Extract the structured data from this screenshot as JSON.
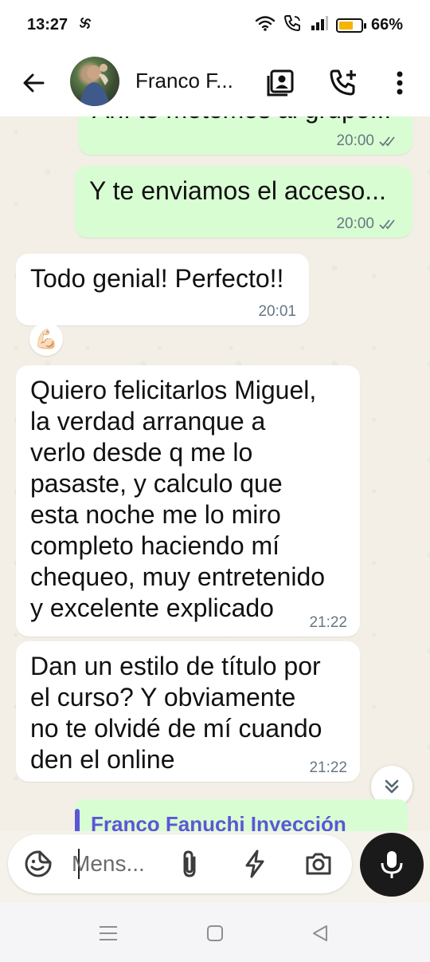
{
  "status_bar": {
    "time": "13:27",
    "extra_icon": "pinwheel-icon",
    "battery_percent": "66%",
    "battery_level": 0.66,
    "battery_color": "#f5b400"
  },
  "header": {
    "contact_name": "Franco F...",
    "back_icon": "arrow-left-icon",
    "icons": [
      "contact-card-icon",
      "add-call-icon",
      "more-vertical-icon"
    ]
  },
  "messages": [
    {
      "direction": "out",
      "text": "Ahí te metemos al grupo...",
      "time": "20:00",
      "status": "read"
    },
    {
      "direction": "out",
      "text": "Y te enviamos el acceso...",
      "time": "20:00",
      "status": "read"
    },
    {
      "direction": "in",
      "text": "Todo genial! Perfecto!!",
      "time": "20:01",
      "reaction": "💪🏻"
    },
    {
      "direction": "in",
      "text": "Quiero felicitarlos Miguel,\nla verdad arranque a\nverlo desde q me lo\npasaste, y calculo que\nesta noche me lo miro\ncompleto haciendo mí\nchequeo, muy entretenido\ny excelente explicado",
      "time": "21:22"
    },
    {
      "direction": "in",
      "text": "Dan un estilo de título por\nel curso? Y obviamente\nno te olvidé de mí cuando\nden el online",
      "time": "21:22"
    }
  ],
  "quoted_preview": {
    "title": "Franco Fanuchi Inyección"
  },
  "composer": {
    "placeholder": "Mens...",
    "icons": [
      "sticker-icon",
      "attach-icon",
      "lightning-icon",
      "camera-icon",
      "mic-icon"
    ]
  },
  "colors": {
    "outgoing_bubble": "#d9fdd3",
    "incoming_bubble": "#ffffff",
    "chat_bg": "#f3efe6",
    "quote_accent": "#5b57d3"
  }
}
